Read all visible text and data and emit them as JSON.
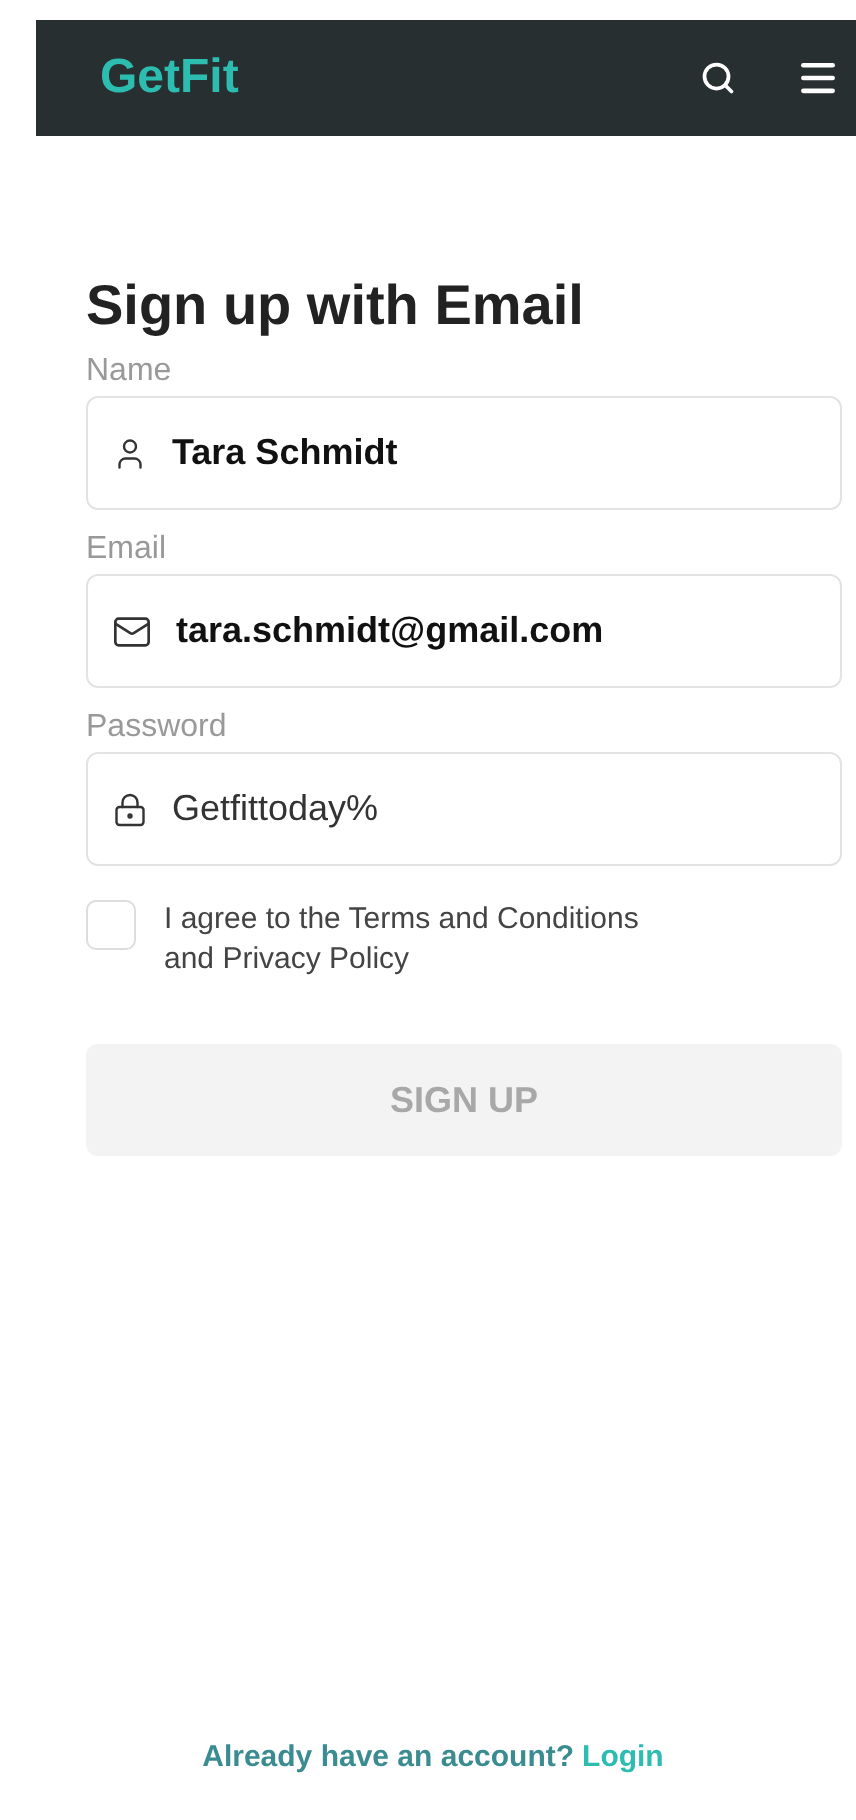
{
  "header": {
    "logo": "GetFit"
  },
  "title": "Sign up with Email",
  "fields": [
    {
      "kind": "name",
      "label": "Name",
      "value": "Tara Schmidt"
    },
    {
      "kind": "email",
      "label": "Email",
      "value": "tara.schmidt@gmail.com"
    },
    {
      "kind": "password",
      "label": "Password",
      "value": "Getfittoday%"
    }
  ],
  "agreement": {
    "checked": false,
    "text": "I agree to the Terms and Conditions and Privacy Policy"
  },
  "submit": {
    "label": "SIGN UP",
    "disabled": true
  },
  "footer": {
    "text": "Already have an account?",
    "link": "Login"
  }
}
